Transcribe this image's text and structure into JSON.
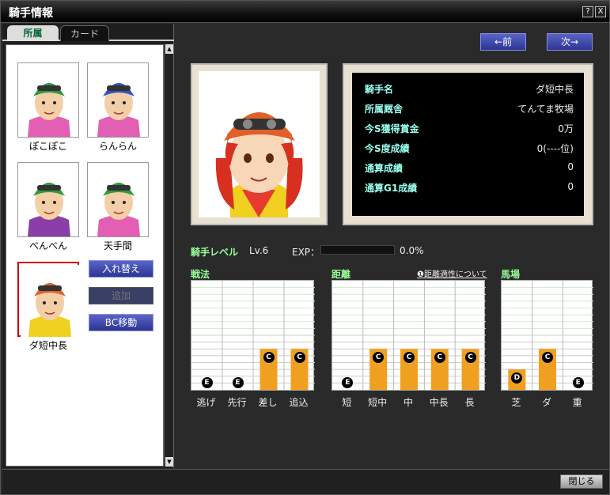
{
  "window": {
    "title": "騎手情報",
    "help_label": "?",
    "close_label": "X"
  },
  "tabs": [
    {
      "label": "所属"
    },
    {
      "label": "カード"
    }
  ],
  "jockeys": [
    {
      "name": "ぽこぽこ",
      "helmet": "#2f9a3c",
      "shirt": "#e35fb4"
    },
    {
      "name": "らんらん",
      "helmet": "#2a55c8",
      "shirt": "#e35fb4"
    },
    {
      "name": "べんべん",
      "helmet": "#2f9a3c",
      "shirt": "#8a3fa8"
    },
    {
      "name": "天手間",
      "helmet": "#2f9a3c",
      "shirt": "#e35fb4"
    },
    {
      "name": "ダ短中長",
      "helmet": "#e0602a",
      "shirt": "#f0d020"
    }
  ],
  "actions": {
    "swap": "入れ替え",
    "add": "追加",
    "bc_move": "BC移動"
  },
  "nav": {
    "prev": "←前",
    "next": "次→"
  },
  "info": [
    {
      "label": "騎手名",
      "value": "ダ短中長"
    },
    {
      "label": "所属厩舎",
      "value": "てんてま牧場"
    },
    {
      "label": "今S獲得賞金",
      "value": "0万"
    },
    {
      "label": "今S度成績",
      "value": "0(----位)"
    },
    {
      "label": "通算成績",
      "value": "0"
    },
    {
      "label": "通算G1成績",
      "value": "0"
    }
  ],
  "level": {
    "label": "騎手レベル",
    "value": "Lv.6",
    "exp_label": "EXP：",
    "exp_value": "0.0%",
    "exp_fraction": 0.0
  },
  "chart_data": [
    {
      "type": "bar",
      "title": "戦法",
      "categories": [
        "逃げ",
        "先行",
        "差し",
        "追込"
      ],
      "grades": [
        "E",
        "E",
        "C",
        "C"
      ],
      "values": [
        0,
        0,
        3,
        3
      ],
      "ylim": [
        0,
        8
      ]
    },
    {
      "type": "bar",
      "title": "距離",
      "categories": [
        "短",
        "短中",
        "中",
        "中長",
        "長"
      ],
      "grades": [
        "E",
        "C",
        "C",
        "C",
        "C"
      ],
      "values": [
        0,
        3,
        3,
        3,
        3
      ],
      "ylim": [
        0,
        8
      ]
    },
    {
      "type": "bar",
      "title": "馬場",
      "categories": [
        "芝",
        "ダ",
        "重"
      ],
      "grades": [
        "D",
        "C",
        "E"
      ],
      "values": [
        1.5,
        3,
        0
      ],
      "ylim": [
        0,
        8
      ]
    }
  ],
  "distance_link": "距離適性について",
  "footer": {
    "close": "閉じる"
  },
  "colors": {
    "bar": "#f0a020",
    "accent": "#9f9"
  }
}
